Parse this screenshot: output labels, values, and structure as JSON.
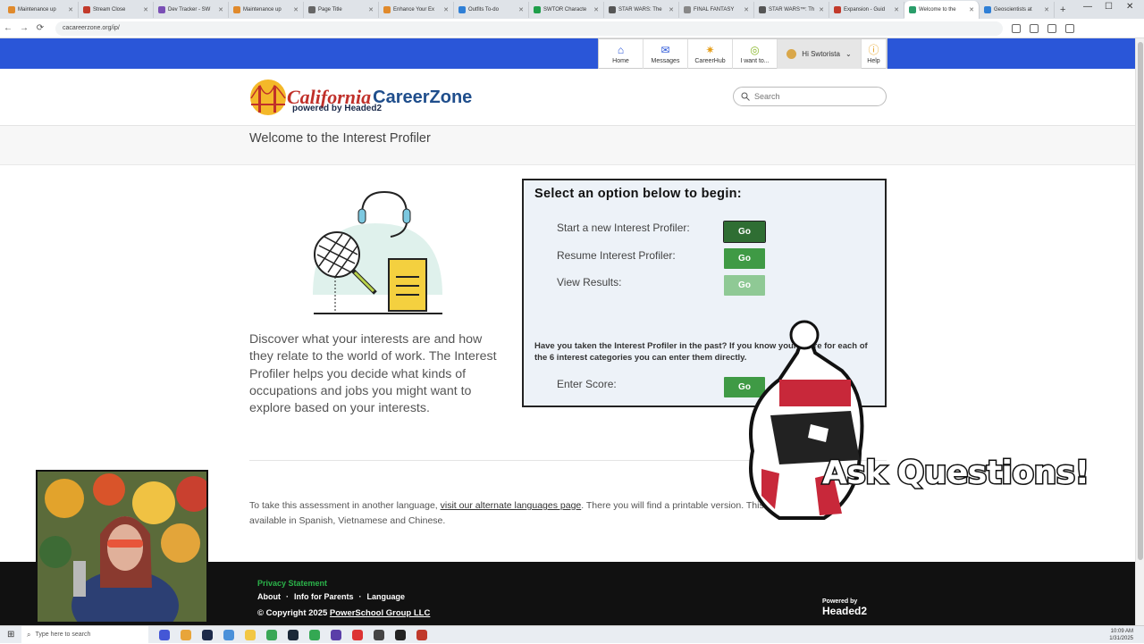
{
  "browser": {
    "tabs": [
      {
        "title": "Maintenance up",
        "color": "#e08a2c"
      },
      {
        "title": "Stream Close",
        "color": "#c23a2b"
      },
      {
        "title": "Dev Tracker - SW",
        "color": "#7a4fb5"
      },
      {
        "title": "Maintenance up",
        "color": "#e08a2c"
      },
      {
        "title": "Page Title",
        "color": "#666"
      },
      {
        "title": "Enhance Your Ex",
        "color": "#e08a2c"
      },
      {
        "title": "Outfits To-do",
        "color": "#2f7fd6"
      },
      {
        "title": "SWTOR Characte",
        "color": "#1f9e4a"
      },
      {
        "title": "STAR WARS: The",
        "color": "#555"
      },
      {
        "title": "FINAL FANTASY",
        "color": "#888"
      },
      {
        "title": "STAR WARS™: Th",
        "color": "#555"
      },
      {
        "title": "Expansion - Guid",
        "color": "#c23a2b"
      },
      {
        "title": "Welcome to the",
        "color": "#2a9d6a"
      },
      {
        "title": "Geoscientists at",
        "color": "#2f7fd6"
      }
    ],
    "new_tab_label": "+",
    "url": "cacareerzone.org/ip/"
  },
  "topnav": {
    "items": [
      {
        "label": "Home",
        "icon": "home-icon",
        "glyph": "⌂"
      },
      {
        "label": "Messages",
        "icon": "mail-icon",
        "glyph": "✉"
      },
      {
        "label": "CareerHub",
        "icon": "star-icon",
        "glyph": "✷"
      },
      {
        "label": "I want to...",
        "icon": "target-icon",
        "glyph": "◎"
      }
    ],
    "user_label": "Hi Swtorista",
    "help_label": "Help"
  },
  "header": {
    "logo_california": "California",
    "logo_careerzone": "CareerZone",
    "logo_powered": "powered by Headed2",
    "search_placeholder": "Search"
  },
  "page_title": "Welcome to the Interest Profiler",
  "intro_text": "Discover what your interests are and how they relate to the world of work. The Interest Profiler helps you decide what kinds of occupations and jobs you might want to explore based on your interests.",
  "options": {
    "heading": "Select an option below to begin:",
    "start_label": "Start a new Interest Profiler:",
    "resume_label": "Resume Interest Profiler:",
    "view_label": "View Results:",
    "go_label": "Go",
    "past_question": "Have you taken the Interest Profiler in the past? If you know your score for each of the 6 interest categories you can enter them directly.",
    "enter_score_label": "Enter Score:"
  },
  "language_note": {
    "before": "To take this assessment in another language, ",
    "link": "visit our alternate languages page",
    "after": ". There you will find a printable version. This instrument is available in Spanish, Vietnamese and Chinese."
  },
  "footer": {
    "privacy": "Privacy Statement",
    "links": [
      "About",
      "Info for Parents",
      "Language"
    ],
    "copyright_prefix": "© Copyright 2025 ",
    "copyright_link": "PowerSchool Group LLC",
    "powered_small": "Powered by",
    "powered_big": "Headed2"
  },
  "overlay": {
    "sticker_text": "Ask Questions!"
  },
  "taskbar": {
    "search_placeholder": "Type here to search",
    "time": "10:09 AM",
    "date": "1/31/2025"
  }
}
